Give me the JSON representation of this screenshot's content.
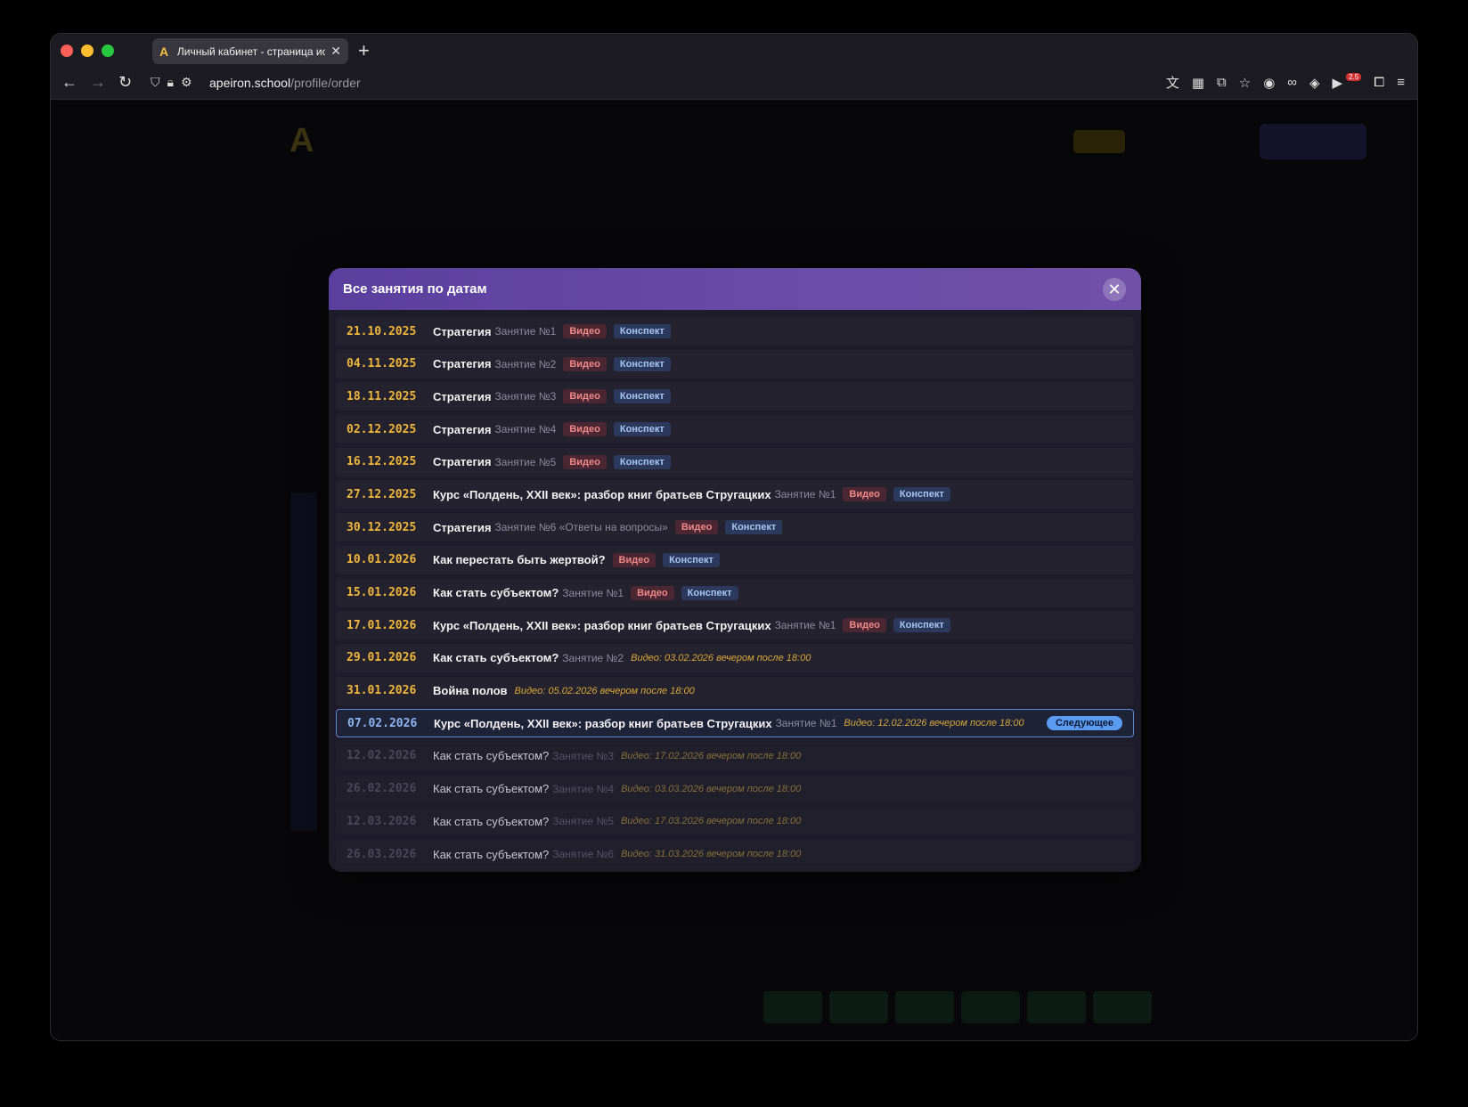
{
  "browser": {
    "tab_title": "Личный кабинет - страница ис",
    "tab_favicon": "A",
    "new_tab": "+",
    "url_host": "apeiron.school",
    "url_path": "/profile/order",
    "ext_badge": "2.5"
  },
  "modal": {
    "title": "Все занятия по датам",
    "close": "✕"
  },
  "lessons": [
    {
      "date": "21.10.2025",
      "title": "Стратегия",
      "lesson": "Занятие №1",
      "video": "Видео",
      "notes": "Конспект"
    },
    {
      "date": "04.11.2025",
      "title": "Стратегия",
      "lesson": "Занятие №2",
      "video": "Видео",
      "notes": "Конспект"
    },
    {
      "date": "18.11.2025",
      "title": "Стратегия",
      "lesson": "Занятие №3",
      "video": "Видео",
      "notes": "Конспект"
    },
    {
      "date": "02.12.2025",
      "title": "Стратегия",
      "lesson": "Занятие №4",
      "video": "Видео",
      "notes": "Конспект"
    },
    {
      "date": "16.12.2025",
      "title": "Стратегия",
      "lesson": "Занятие №5",
      "video": "Видео",
      "notes": "Конспект"
    },
    {
      "date": "27.12.2025",
      "title": "Курс «Полдень, XXII век»: разбор книг братьев Стругацких",
      "lesson": "Занятие №1",
      "video": "Видео",
      "notes": "Конспект"
    },
    {
      "date": "30.12.2025",
      "title": "Стратегия",
      "lesson": "Занятие №6 «Ответы на вопросы»",
      "video": "Видео",
      "notes": "Конспект"
    },
    {
      "date": "10.01.2026",
      "title": "Как перестать быть жертвой?",
      "lesson": "",
      "video": "Видео",
      "notes": "Конспект"
    },
    {
      "date": "15.01.2026",
      "title": "Как стать субъектом?",
      "lesson": "Занятие №1",
      "video": "Видео",
      "notes": "Конспект"
    },
    {
      "date": "17.01.2026",
      "title": "Курс «Полдень, XXII век»: разбор книг братьев Стругацких",
      "lesson": "Занятие №1",
      "video": "Видео",
      "notes": "Конспект"
    },
    {
      "date": "29.01.2026",
      "title": "Как стать субъектом?",
      "lesson": "Занятие №2",
      "video_date": "Видео: 03.02.2026 вечером после 18:00"
    },
    {
      "date": "31.01.2026",
      "title": "Война полов",
      "lesson": "",
      "video_date": "Видео: 05.02.2026 вечером после 18:00"
    },
    {
      "date": "07.02.2026",
      "title": "Курс «Полдень, XXII век»: разбор книг братьев Стругацких",
      "lesson": "Занятие №1",
      "video_date": "Видео: 12.02.2026 вечером после 18:00",
      "badge": "Следующее"
    },
    {
      "date": "12.02.2026",
      "title": "Как стать субъектом?",
      "lesson": "Занятие №3",
      "video_date": "Видео: 17.02.2026 вечером после 18:00"
    },
    {
      "date": "26.02.2026",
      "title": "Как стать субъектом?",
      "lesson": "Занятие №4",
      "video_date": "Видео: 03.03.2026 вечером после 18:00"
    },
    {
      "date": "12.03.2026",
      "title": "Как стать субъектом?",
      "lesson": "Занятие №5",
      "video_date": "Видео: 17.03.2026 вечером после 18:00"
    },
    {
      "date": "26.03.2026",
      "title": "Как стать субъектом?",
      "lesson": "Занятие №6",
      "video_date": "Видео: 31.03.2026 вечером после 18:00"
    }
  ]
}
